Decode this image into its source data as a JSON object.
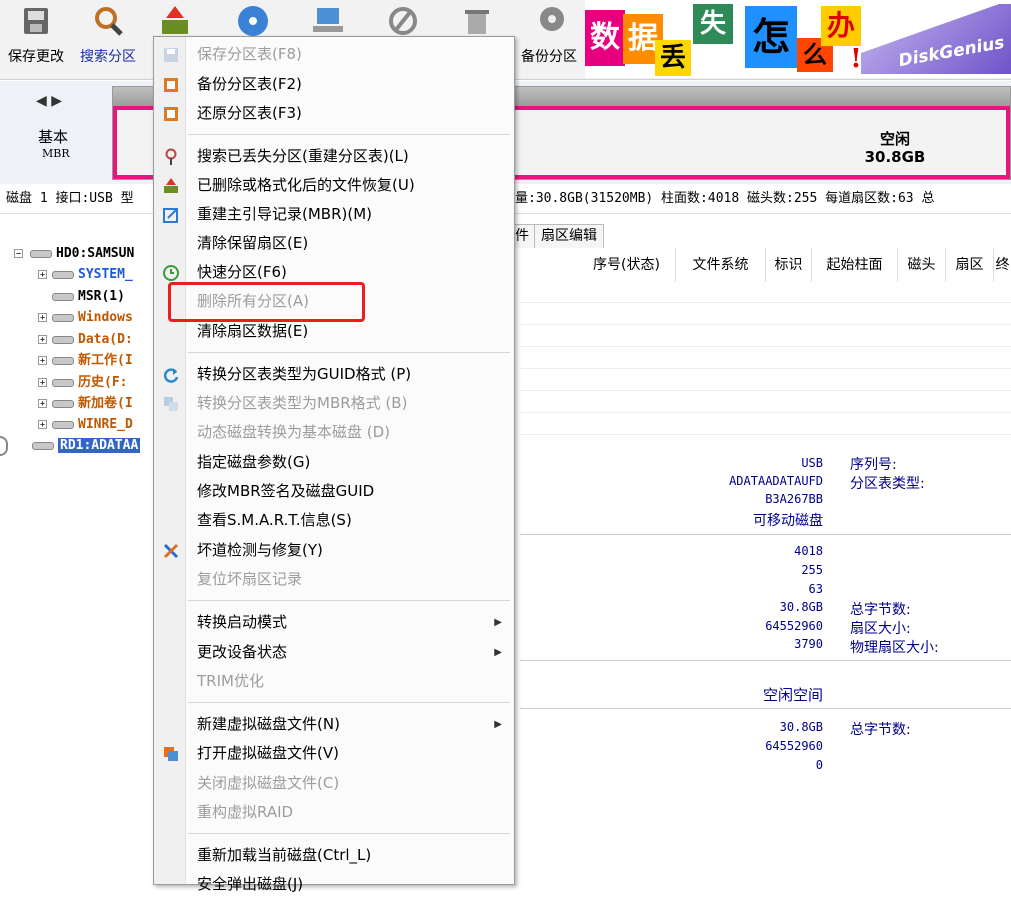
{
  "toolbar": {
    "buttons": [
      {
        "label": "保存更改",
        "icon": "save-icon"
      },
      {
        "label": "搜索分区",
        "icon": "magnifier-icon"
      },
      {
        "label": "",
        "icon": "recover-icon"
      },
      {
        "label": "",
        "icon": "disc-icon"
      },
      {
        "label": "",
        "icon": "laptop-icon"
      },
      {
        "label": "",
        "icon": "delete-icon"
      },
      {
        "label": "",
        "icon": "trash-icon"
      },
      {
        "label": "备份分区",
        "icon": "backup-icon"
      }
    ],
    "banner_chars": [
      "数",
      "据",
      "丢",
      "失",
      "怎",
      "么",
      "办",
      "!"
    ],
    "banner_logo": "DiskGenius"
  },
  "disk_panel": {
    "nav": "◀ ▶",
    "type": "基本",
    "scheme": "MBR",
    "free_label": "空闲",
    "free_size": "30.8GB"
  },
  "info_line": "磁盘 1 接口:USB  型",
  "info_line_right": "量:30.8GB(31520MB)  柱面数:4018  磁头数:255  每道扇区数:63  总",
  "tree": {
    "items": [
      {
        "text": "HD0:SAMSUN",
        "color": "#000"
      },
      {
        "text": "SYSTEM_",
        "color": "#1e5ad7"
      },
      {
        "text": "MSR(1)",
        "color": "#000"
      },
      {
        "text": "Windows",
        "color": "#c05800"
      },
      {
        "text": "Data(D:",
        "color": "#c05800"
      },
      {
        "text": "新工作(I",
        "color": "#c05800"
      },
      {
        "text": "历史(F:",
        "color": "#c05800"
      },
      {
        "text": "新加卷(I",
        "color": "#c05800"
      },
      {
        "text": "WINRE_D",
        "color": "#c05800"
      },
      {
        "text": "RD1:ADATAA",
        "color": "#fff"
      }
    ]
  },
  "grid": {
    "tabs": [
      "件",
      "扇区编辑"
    ],
    "headers": [
      "序号(状态)",
      "文件系统",
      "标识",
      "起始柱面",
      "磁头",
      "扇区",
      "终"
    ]
  },
  "details": {
    "values_a": [
      "USB",
      "ADATAADATAUFD",
      "B3A267BB",
      "可移动磁盘"
    ],
    "labels_a": [
      "序列号:",
      "分区表类型:"
    ],
    "values_b": [
      "4018",
      "255",
      "63",
      "30.8GB",
      "64552960",
      "3790"
    ],
    "labels_b": [
      "总字节数:",
      "扇区大小:",
      "物理扇区大小:"
    ],
    "free_space": "空闲空间",
    "values_c": [
      "30.8GB",
      "64552960",
      "0"
    ],
    "labels_c": [
      "总字节数:"
    ]
  },
  "menu": {
    "items": [
      {
        "label": "保存分区表(F8)",
        "disabled": true,
        "icon": "save-icon"
      },
      {
        "label": "备份分区表(F2)",
        "disabled": false,
        "icon": "backup-icon"
      },
      {
        "label": "还原分区表(F3)",
        "disabled": false,
        "icon": "restore-icon"
      },
      {
        "label": "搜索已丢失分区(重建分区表)(L)",
        "disabled": false,
        "icon": "search-icon"
      },
      {
        "label": "已删除或格式化后的文件恢复(U)",
        "disabled": false,
        "icon": "recover-icon"
      },
      {
        "label": "重建主引导记录(MBR)(M)",
        "disabled": false,
        "icon": "edit-icon"
      },
      {
        "label": "清除保留扇区(E)",
        "disabled": false,
        "icon": ""
      },
      {
        "label": "快速分区(F6)",
        "disabled": false,
        "icon": "clock-icon"
      },
      {
        "label": "删除所有分区(A)",
        "disabled": true,
        "icon": ""
      },
      {
        "label": "清除扇区数据(E)",
        "disabled": false,
        "icon": ""
      },
      {
        "label": "转换分区表类型为GUID格式 (P)",
        "disabled": false,
        "icon": "convert-icon"
      },
      {
        "label": "转换分区表类型为MBR格式 (B)",
        "disabled": true,
        "icon": "convert2-icon"
      },
      {
        "label": "动态磁盘转换为基本磁盘 (D)",
        "disabled": true,
        "icon": ""
      },
      {
        "label": "指定磁盘参数(G)",
        "disabled": false,
        "icon": ""
      },
      {
        "label": "修改MBR签名及磁盘GUID",
        "disabled": false,
        "icon": ""
      },
      {
        "label": "查看S.M.A.R.T.信息(S)",
        "disabled": false,
        "icon": ""
      },
      {
        "label": "坏道检测与修复(Y)",
        "disabled": false,
        "icon": "tools-icon"
      },
      {
        "label": "复位坏扇区记录",
        "disabled": true,
        "icon": ""
      },
      {
        "label": "转换启动模式",
        "disabled": false,
        "icon": "",
        "submenu": true
      },
      {
        "label": "更改设备状态",
        "disabled": false,
        "icon": "",
        "submenu": true
      },
      {
        "label": "TRIM优化",
        "disabled": true,
        "icon": ""
      },
      {
        "label": "新建虚拟磁盘文件(N)",
        "disabled": false,
        "icon": "",
        "submenu": true
      },
      {
        "label": "打开虚拟磁盘文件(V)",
        "disabled": false,
        "icon": "vdisk-icon"
      },
      {
        "label": "关闭虚拟磁盘文件(C)",
        "disabled": true,
        "icon": ""
      },
      {
        "label": "重构虚拟RAID",
        "disabled": true,
        "icon": ""
      },
      {
        "label": "重新加载当前磁盘(Ctrl_L)",
        "disabled": false,
        "icon": ""
      },
      {
        "label": "安全弹出磁盘(J)",
        "disabled": false,
        "icon": ""
      }
    ]
  },
  "colors": {
    "highlight_box": "#ee1c1c",
    "partition_border": "#e8157e",
    "detail_text": "#00008b"
  }
}
